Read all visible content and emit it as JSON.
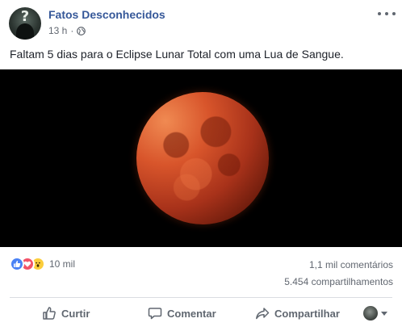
{
  "post": {
    "page_name": "Fatos Desconhecidos",
    "time": "13 h",
    "separator": "·",
    "privacy_icon": "globe-icon",
    "avatar_glyph": "?",
    "text": "Faltam 5 dias para o Eclipse Lunar Total com uma Lua de Sangue."
  },
  "photo": {
    "subject": "moon-icon"
  },
  "stats": {
    "reactions": [
      "like-icon",
      "love-icon",
      "wow-icon"
    ],
    "reaction_count": "10 mil",
    "comments": "1,1 mil comentários",
    "shares": "5.454 compartilhamentos"
  },
  "actions": {
    "like": "Curtir",
    "comment": "Comentar",
    "share": "Compartilhar"
  },
  "colors": {
    "link": "#365899",
    "secondary_text": "#616770",
    "action_text": "#606770",
    "like": "#4a82f5",
    "love": "#f25268",
    "wow": "#fbcd3c"
  }
}
